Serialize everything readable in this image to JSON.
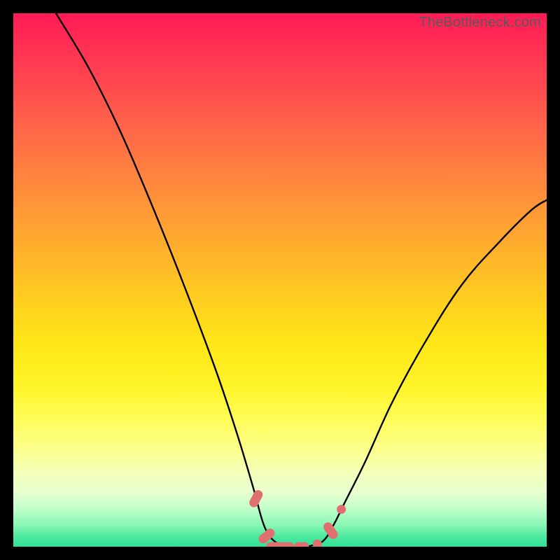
{
  "watermark": "TheBottleneck.com",
  "chart_data": {
    "type": "line",
    "title": "",
    "xlabel": "",
    "ylabel": "",
    "x_range": [
      0,
      100
    ],
    "y_range": [
      0,
      100
    ],
    "note": "Axes are implicit (no tick labels visible). y is a bottleneck-percentage-like measure (0 = good/green at bottom, 100 = bad/red at top). Two curves: the left one falls from top-left to a flat minimum near x≈48–56, the right one rises from that minimum toward upper right with gentle curvature.",
    "series": [
      {
        "name": "left-curve",
        "points": [
          {
            "x": 8,
            "y": 100
          },
          {
            "x": 14,
            "y": 90
          },
          {
            "x": 20,
            "y": 78
          },
          {
            "x": 26,
            "y": 64
          },
          {
            "x": 32,
            "y": 49
          },
          {
            "x": 38,
            "y": 33
          },
          {
            "x": 42,
            "y": 21
          },
          {
            "x": 45,
            "y": 11
          },
          {
            "x": 47,
            "y": 4
          },
          {
            "x": 49,
            "y": 1
          },
          {
            "x": 52,
            "y": 0
          },
          {
            "x": 55,
            "y": 0
          }
        ]
      },
      {
        "name": "right-curve",
        "points": [
          {
            "x": 55,
            "y": 0
          },
          {
            "x": 58,
            "y": 1
          },
          {
            "x": 60,
            "y": 4
          },
          {
            "x": 62,
            "y": 8
          },
          {
            "x": 66,
            "y": 16
          },
          {
            "x": 71,
            "y": 27
          },
          {
            "x": 77,
            "y": 38
          },
          {
            "x": 84,
            "y": 49
          },
          {
            "x": 91,
            "y": 57
          },
          {
            "x": 97,
            "y": 63
          },
          {
            "x": 100,
            "y": 65
          }
        ]
      }
    ],
    "markers": [
      {
        "x": 45.5,
        "y": 9,
        "shape": "pill",
        "angle": -62
      },
      {
        "x": 47.5,
        "y": 2,
        "shape": "pill",
        "angle": -40
      },
      {
        "x": 50,
        "y": 0,
        "shape": "bar"
      },
      {
        "x": 54,
        "y": 0,
        "shape": "bar-short"
      },
      {
        "x": 57,
        "y": 0.5,
        "shape": "dot"
      },
      {
        "x": 59.5,
        "y": 3,
        "shape": "pill",
        "angle": 55
      },
      {
        "x": 61.5,
        "y": 7,
        "shape": "dot"
      }
    ],
    "background_gradient": {
      "top": "#ff1a56",
      "mid": "#ffe617",
      "bottom": "#2de296"
    }
  }
}
